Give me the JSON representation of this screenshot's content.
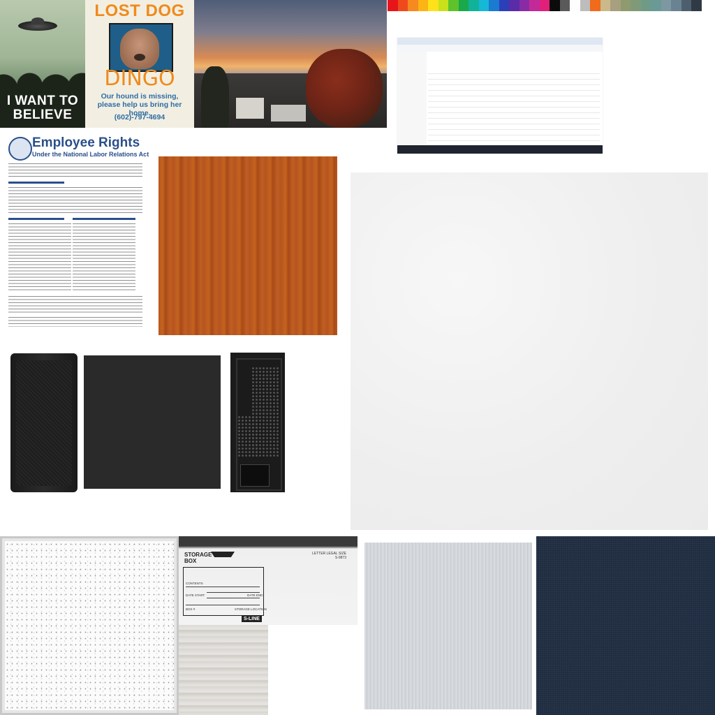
{
  "ufo_poster": {
    "line1": "I WANT TO",
    "line2": "BELIEVE"
  },
  "lost_dog_poster": {
    "heading": "LOST DOG",
    "name": "DINGO",
    "message": "Our hound is missing, please help us bring her home.",
    "phone": "(602)-797-4694"
  },
  "employee_rights": {
    "title": "Employee Rights",
    "subtitle": "Under the National Labor Relations Act"
  },
  "storage_box": {
    "title_line1": "STORAGE",
    "title_line2": "BOX",
    "size_line1": "LETTER LEGAL SIZE",
    "size_line2": "S-9873",
    "label_contents": "CONTENTS",
    "label_date_start": "DATE START",
    "label_date_end": "DATE END",
    "label_box_no": "BOX #",
    "label_location": "STORAGE LOCATION",
    "brand": "S-LINE"
  },
  "palette_colors": [
    "#e8141b",
    "#f04a1c",
    "#f6891f",
    "#fbb413",
    "#ffe11a",
    "#c9e11b",
    "#5fc22a",
    "#1aa94a",
    "#10b39a",
    "#15b8d6",
    "#1a7bd1",
    "#2b3fb8",
    "#5a2ca8",
    "#8a2ba6",
    "#c22a9a",
    "#e0207a",
    "#0b0b0b",
    "#5a5a5a",
    "#fdfdfd",
    "#bdbdbd",
    "#f06b1b",
    "#cbb98a",
    "#a79f7e",
    "#8f9a6e",
    "#7f9a78",
    "#6f9b86",
    "#6a9a95",
    "#7d98a1",
    "#6a8393",
    "#4d5f6f",
    "#2f3a46"
  ]
}
